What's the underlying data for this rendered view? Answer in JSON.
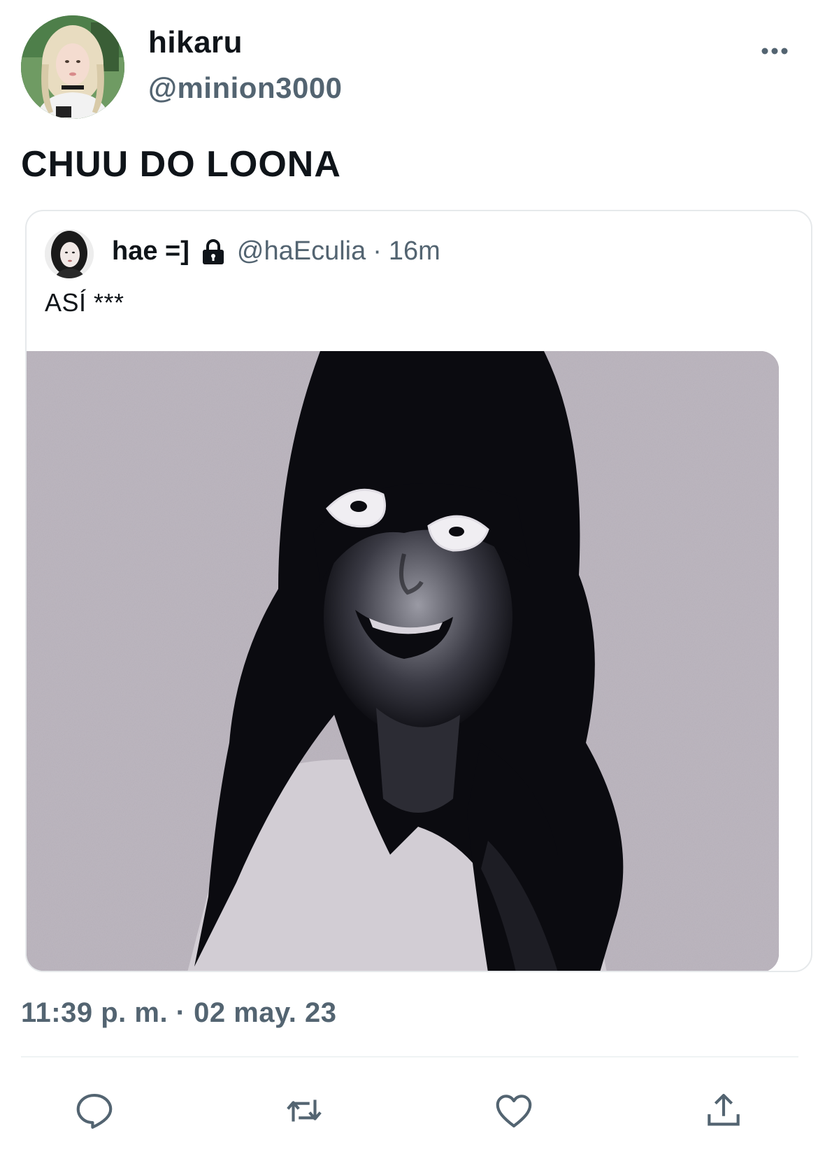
{
  "author": {
    "display_name": "hikaru",
    "handle": "@minion3000",
    "avatar_icon": "profile-photo"
  },
  "tweet": {
    "text": "CHUU DO LOONA",
    "timestamp": "11:39 p. m. · 02 may. 23"
  },
  "quoted_tweet": {
    "display_name": "hae =]",
    "protected_icon": "lock-icon",
    "handle": "@haEculia",
    "separator": "·",
    "relative_time": "16m",
    "text": "ASÍ ***"
  },
  "actions": {
    "more_icon": "more-icon",
    "reply_icon": "reply-icon",
    "retweet_icon": "retweet-icon",
    "like_icon": "heart-icon",
    "share_icon": "share-icon"
  },
  "colors": {
    "text_primary": "#0f1419",
    "text_secondary": "#536471",
    "border": "#e6e9eb",
    "background": "#ffffff"
  }
}
